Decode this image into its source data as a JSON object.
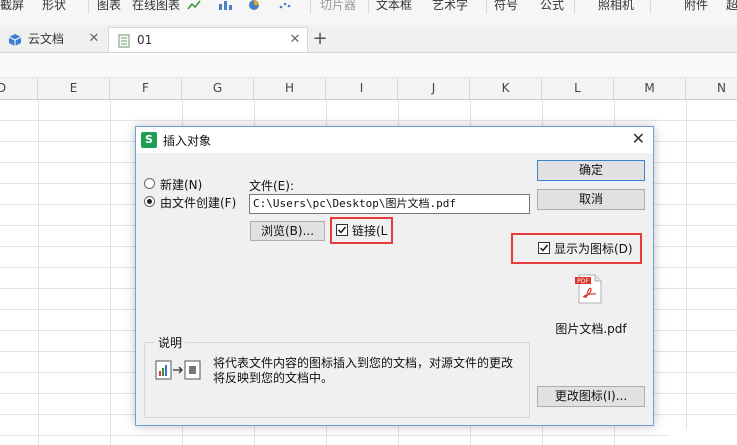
{
  "ribbon": {
    "items": [
      "截屏",
      "形状",
      "图表",
      "在线图表",
      "切片器",
      "文本框",
      "艺术字",
      "符号",
      "公式",
      "照相机",
      "附件",
      "超"
    ]
  },
  "tabs": [
    {
      "label": "云文档",
      "active": false
    },
    {
      "label": "01",
      "active": true
    }
  ],
  "columns": [
    "D",
    "E",
    "F",
    "G",
    "H",
    "I",
    "J",
    "K",
    "L",
    "M",
    "N"
  ],
  "dialog": {
    "title": "插入对象",
    "radio_new": "新建(N)",
    "radio_from_file": "由文件创建(F)",
    "file_label": "文件(E):",
    "file_path": "C:\\Users\\pc\\Desktop\\图片文档.pdf",
    "browse_button": "浏览(B)...",
    "link_checkbox": "链接(L",
    "display_as_icon": "显示为图标(D)",
    "ok_button": "确定",
    "cancel_button": "取消",
    "icon_filename": "图片文档.pdf",
    "change_icon_button": "更改图标(I)...",
    "explain_title": "说明",
    "explain_text": "将代表文件内容的图标插入到您的文档，对源文件的更改将反映到您的文档中。",
    "pdf_badge": "PDF",
    "highlight_color": "#e53b3b"
  }
}
